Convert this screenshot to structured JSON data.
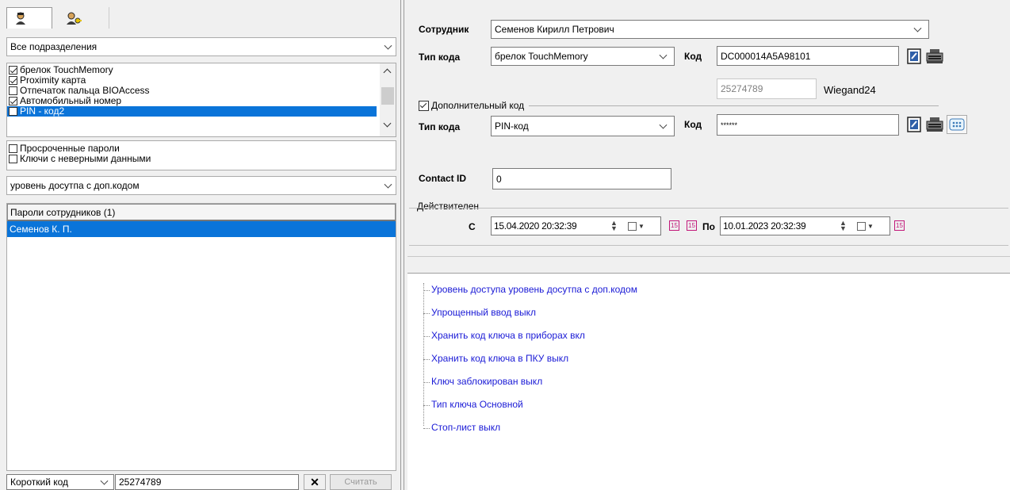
{
  "left": {
    "tabs": [
      "employee-icon",
      "key-employee-icon"
    ],
    "department_combo": "Все подразделения",
    "key_types": [
      {
        "label": "брелок TouchMemory",
        "checked": true
      },
      {
        "label": "Proximity карта",
        "checked": true
      },
      {
        "label": "Отпечаток пальца BIOAccess",
        "checked": false
      },
      {
        "label": "Автомобильный номер",
        "checked": true
      },
      {
        "label": "PIN - код2",
        "checked": false
      }
    ],
    "filters": [
      {
        "label": "Просроченные пароли",
        "checked": false
      },
      {
        "label": "Ключи с неверными данными",
        "checked": false
      }
    ],
    "access_level_combo": "уровень досутпа с доп.кодом",
    "list_header": "Пароли сотрудников  (1)",
    "list_items": [
      "Семенов К. П."
    ],
    "bottom": {
      "code_type": "Короткий код",
      "code_value": "25274789",
      "clear": "✕",
      "read_button": "Считать"
    }
  },
  "right": {
    "employee_label": "Сотрудник",
    "employee_value": "Семенов Кирилл Петрович",
    "code_type_label": "Тип кода",
    "code_type_value": "брелок TouchMemory",
    "code_label": "Код",
    "code_value": "DC000014A5A98101",
    "wiegand_value": "25274789",
    "wiegand_label": "Wiegand24",
    "extra_code_label": "Дополнительный код",
    "extra_code_checked": true,
    "code_type2_label": "Тип кода",
    "code_type2_value": "PIN-код",
    "code2_label": "Код",
    "code2_value": "******",
    "contact_id_label": "Contact ID",
    "contact_id_value": "0",
    "valid_label": "Действителен",
    "from_label": "С",
    "from_value": "15.04.2020 20:32:39",
    "to_label": "По",
    "to_value": "10.01.2023 20:32:39",
    "properties": [
      "Уровень доступа  уровень досутпа с доп.кодом",
      "Упрощенный ввод  выкл",
      "Хранить код ключа в приборах  вкл",
      "Хранить код ключа в ПКУ  выкл",
      "Ключ заблокирован  выкл",
      "Тип ключа  Основной",
      "Стоп-лист  выкл"
    ]
  },
  "colors": {
    "selection": "#0a74d9",
    "link": "#1a1ad6"
  }
}
